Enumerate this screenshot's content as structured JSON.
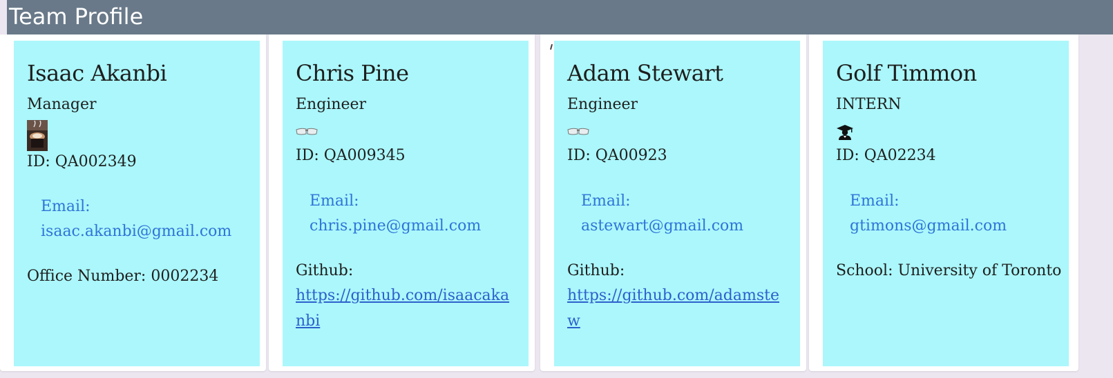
{
  "header": {
    "title": "Team Profile"
  },
  "employees": [
    {
      "name": "Isaac Akanbi",
      "role": "Manager",
      "icon": "coffee-cup-photo-icon",
      "id_line": "ID: QA002349",
      "email_label": "Email:",
      "email": "isaac.akanbi@gmail.com",
      "extra_text": "Office Number: 0002234"
    },
    {
      "name": "Chris Pine",
      "role": "Engineer",
      "icon": "safety-glasses-icon",
      "id_line": "ID: QA009345",
      "email_label": "Email:",
      "email": "chris.pine@gmail.com",
      "extra_label": "Github:",
      "extra_link": "https://github.com/isaacakanbi"
    },
    {
      "name": "Adam Stewart",
      "role": "Engineer",
      "icon": "safety-glasses-icon",
      "id_line": "ID: QA00923",
      "email_label": "Email:",
      "email": "astewart@gmail.com",
      "extra_label": "Github:",
      "extra_link": "https://github.com/adamstew"
    },
    {
      "name": "Golf Timmon",
      "role": "INTERN",
      "icon": "graduate-icon",
      "id_line": "ID: QA02234",
      "email_label": "Email:",
      "email": "gtimons@gmail.com",
      "extra_text": "School: University of Toronto"
    }
  ]
}
